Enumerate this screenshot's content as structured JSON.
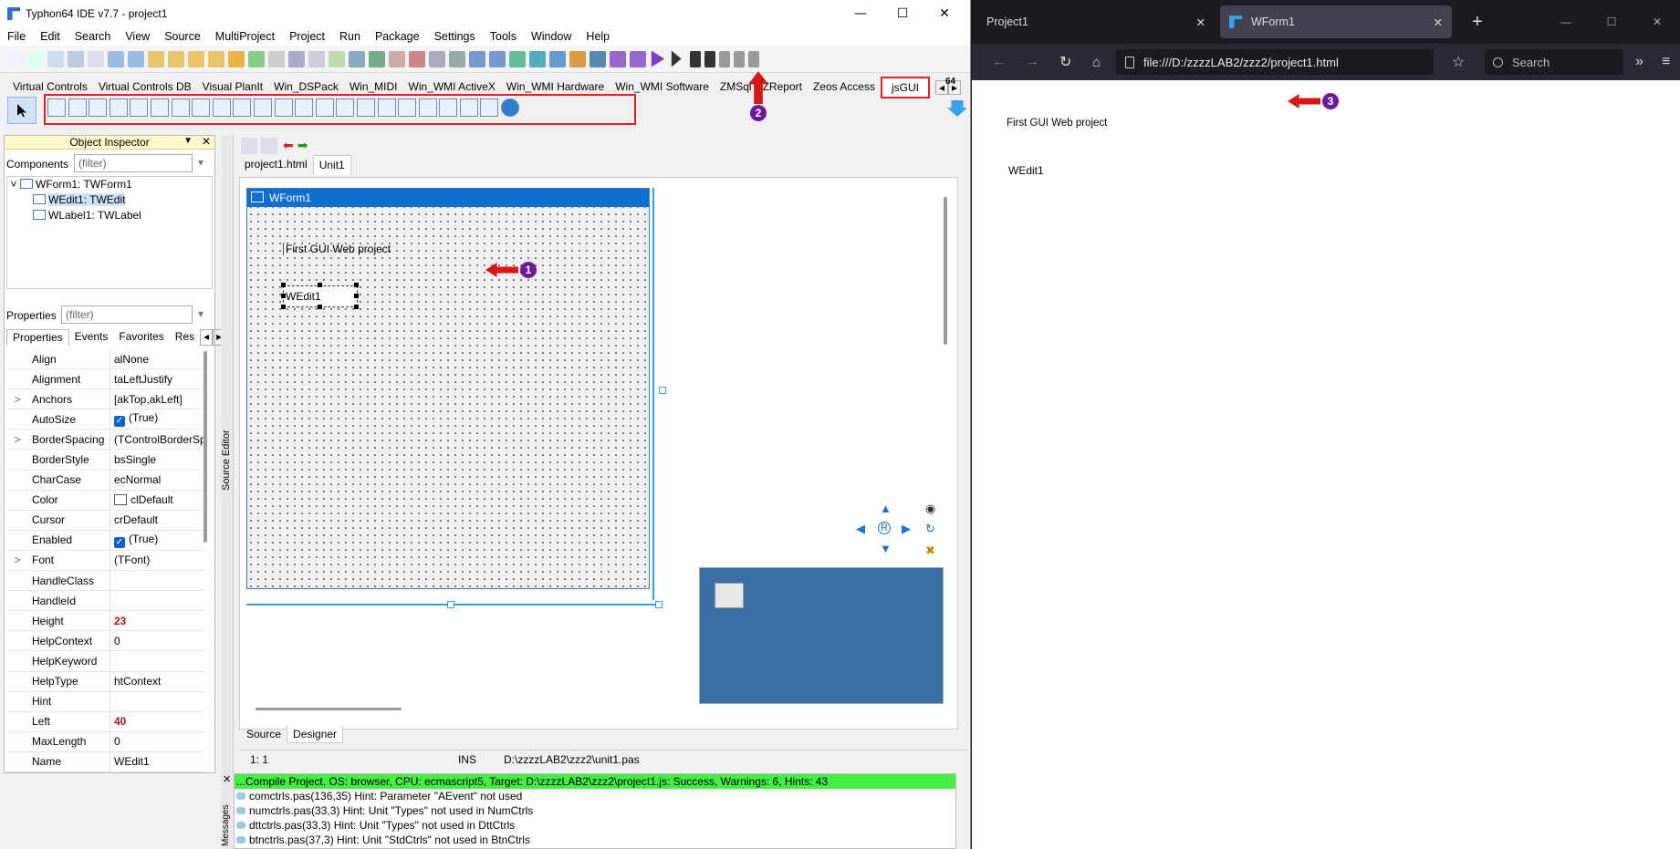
{
  "ide": {
    "title": "Typhon64 IDE v7.7 - project1",
    "menu": [
      "File",
      "Edit",
      "Search",
      "View",
      "Source",
      "MultiProject",
      "Project",
      "Run",
      "Package",
      "Settings",
      "Tools",
      "Window",
      "Help"
    ],
    "palette_tabs": [
      "Virtual Controls",
      "Virtual Controls DB",
      "Visual PlanIt",
      "Win_DSPack",
      "Win_MIDI",
      "Win_WMI ActiveX",
      "Win_WMI Hardware",
      "Win_WMI Software",
      "ZMSql",
      "ZReport",
      "Zeos Access",
      "jsGUI"
    ],
    "palette_right_label": "64",
    "object_inspector": {
      "title": "Object Inspector",
      "components_label": "Components",
      "components_filter": "(filter)",
      "tree": [
        "WForm1: TWForm1",
        "WEdit1: TWEdit",
        "WLabel1: TWLabel"
      ],
      "properties_label": "Properties",
      "properties_filter": "(filter)",
      "tabs": [
        "Properties",
        "Events",
        "Favorites",
        "Res"
      ],
      "props": [
        {
          "n": "Align",
          "v": "alNone",
          "exp": "",
          "hl": false,
          "chk": false
        },
        {
          "n": "Alignment",
          "v": "taLeftJustify",
          "exp": "",
          "hl": false,
          "chk": false
        },
        {
          "n": "Anchors",
          "v": "[akTop,akLeft]",
          "exp": ">",
          "hl": false,
          "chk": false
        },
        {
          "n": "AutoSize",
          "v": "(True)",
          "exp": "",
          "hl": false,
          "chk": true
        },
        {
          "n": "BorderSpacing",
          "v": "(TControlBorderSp",
          "exp": ">",
          "hl": false,
          "chk": false
        },
        {
          "n": "BorderStyle",
          "v": "bsSingle",
          "exp": "",
          "hl": false,
          "chk": false
        },
        {
          "n": "CharCase",
          "v": "ecNormal",
          "exp": "",
          "hl": false,
          "chk": false
        },
        {
          "n": "Color",
          "v": "clDefault",
          "exp": "",
          "hl": false,
          "chk": false,
          "swatch": true
        },
        {
          "n": "Cursor",
          "v": "crDefault",
          "exp": "",
          "hl": false,
          "chk": false
        },
        {
          "n": "Enabled",
          "v": "(True)",
          "exp": "",
          "hl": false,
          "chk": true
        },
        {
          "n": "Font",
          "v": "(TFont)",
          "exp": ">",
          "hl": false,
          "chk": false
        },
        {
          "n": "HandleClass",
          "v": "",
          "exp": "",
          "hl": false,
          "chk": false
        },
        {
          "n": "HandleId",
          "v": "",
          "exp": "",
          "hl": false,
          "chk": false
        },
        {
          "n": "Height",
          "v": "23",
          "exp": "",
          "hl": true,
          "chk": false
        },
        {
          "n": "HelpContext",
          "v": "0",
          "exp": "",
          "hl": false,
          "chk": false
        },
        {
          "n": "HelpKeyword",
          "v": "",
          "exp": "",
          "hl": false,
          "chk": false
        },
        {
          "n": "HelpType",
          "v": "htContext",
          "exp": "",
          "hl": false,
          "chk": false
        },
        {
          "n": "Hint",
          "v": "",
          "exp": "",
          "hl": false,
          "chk": false
        },
        {
          "n": "Left",
          "v": "40",
          "exp": "",
          "hl": true,
          "chk": false
        },
        {
          "n": "MaxLength",
          "v": "0",
          "exp": "",
          "hl": false,
          "chk": false
        },
        {
          "n": "Name",
          "v": "WEdit1",
          "exp": "",
          "hl": false,
          "chk": false
        }
      ]
    },
    "source_editor_label": "Source Editor",
    "editor_tabs": [
      "project1.html",
      "Unit1"
    ],
    "form_title": "WForm1",
    "label_text": "First GUI Web project",
    "edit_text": "WEdit1",
    "bottom_tabs": [
      "Source",
      "Designer"
    ],
    "status": {
      "pos": "1:  1",
      "mode": "INS",
      "file": "D:\\zzzzLAB2\\zzz2\\unit1.pas"
    },
    "messages_label": "Messages",
    "messages": [
      "...Compile Project, OS: browser, CPU: ecmascript5, Target: D:\\zzzzLAB2\\zzz2\\project1.js: Success, Warnings: 6, Hints: 43",
      "comctrls.pas(136,35) Hint: Parameter \"AEvent\" not used",
      "numctrls.pas(33,3) Hint: Unit \"Types\" not used in NumCtrls",
      "dttctrls.pas(33,3) Hint: Unit \"Types\" not used in DttCtrls",
      "btnctrls.pas(37,3) Hint: Unit \"StdCtrls\" not used in BtnCtrls"
    ],
    "badges": [
      "1",
      "2",
      "3"
    ]
  },
  "browser": {
    "tabs": [
      "Project1",
      "WForm1"
    ],
    "url": "file:///D:/zzzzLAB2/zzz2/project1.html",
    "search_placeholder": "Search",
    "page_label": "First GUI Web project",
    "page_edit": "WEdit1"
  },
  "colors": {
    "ide_accent": "#0f6fd1",
    "annot_red": "#d71818",
    "badge_purple": "#6a1b9a",
    "success_green": "#44ee44",
    "browser_dark": "#1c1b22"
  }
}
